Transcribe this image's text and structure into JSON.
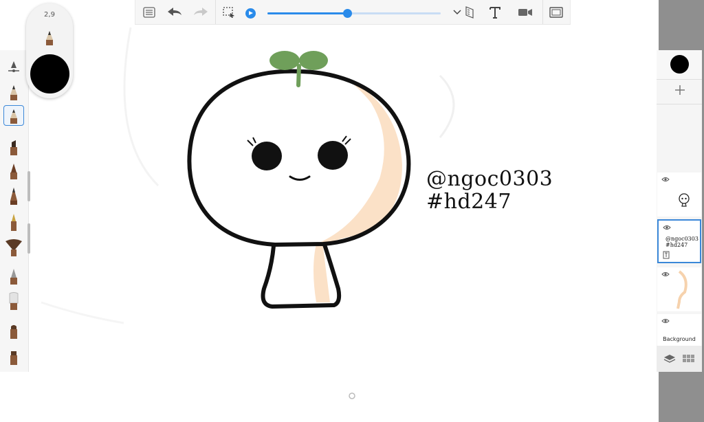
{
  "toolbar": {
    "icons": [
      "list-icon",
      "undo-icon",
      "redo-icon",
      "selection-icon",
      "play-icon",
      "chevron-down-icon",
      "ruler-icon",
      "text-icon",
      "video-icon",
      "fullscreen-icon"
    ],
    "playback_progress": 0.46,
    "colors": {
      "accent": "#2a8bea",
      "track": "#c8dcf4"
    }
  },
  "brush_size": {
    "value": "2,9",
    "color": "#000000"
  },
  "brushes": [
    "pencil",
    "pencil",
    "marker",
    "pen",
    "pen",
    "fountain-pen",
    "fan-brush",
    "airbrush",
    "paint-brush",
    "chisel-marker",
    "chisel-marker"
  ],
  "canvas": {
    "signature_line1": "@ngoc0303",
    "signature_line2": "#hd247",
    "colors": {
      "leaf": "#6f9f5a",
      "skin_shade": "#fbe1c7",
      "outline": "#111111"
    }
  },
  "layers_panel": {
    "current_color": "#000000",
    "layers": [
      {
        "name": "",
        "thumb": "face"
      },
      {
        "name": "@ngoc0303\n#hd247",
        "thumb": "text",
        "active": true
      },
      {
        "name": "",
        "thumb": "shade"
      },
      {
        "name": "Background",
        "thumb": "bg"
      }
    ]
  }
}
